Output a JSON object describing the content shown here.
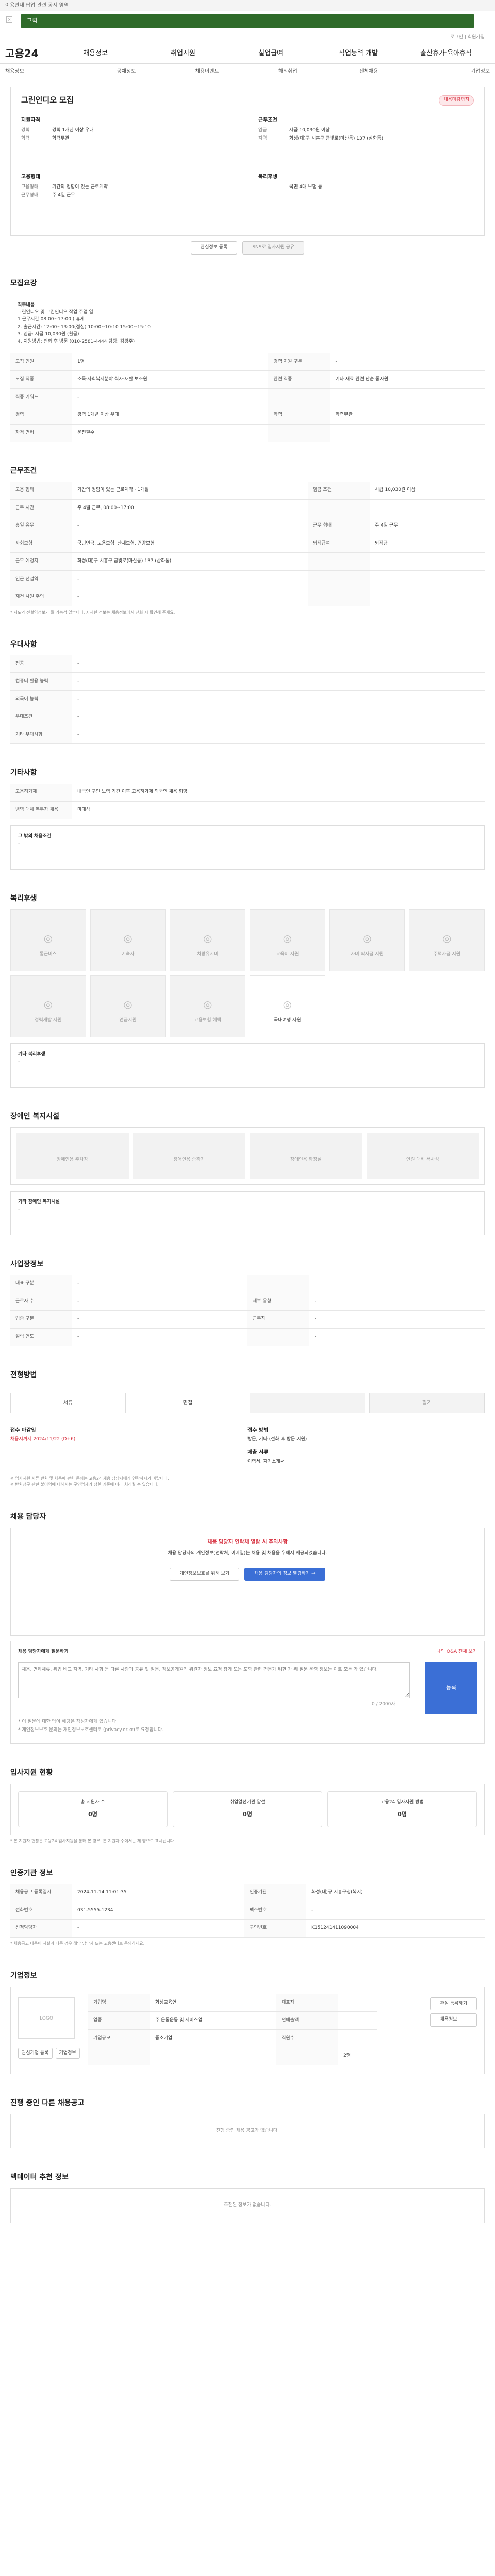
{
  "topbar": {
    "notice": "이용안내 팝업 관련 공지 영역"
  },
  "search": {
    "value": "고퀵"
  },
  "util": {
    "links": "로그인 | 회원가입"
  },
  "gnb": {
    "logo": "고용24",
    "items": [
      "채용정보",
      "취업지원",
      "실업급여",
      "직업능력 개발",
      "출산휴가·육아휴직"
    ]
  },
  "lnb": {
    "items": [
      "채용정보",
      "공채정보",
      "채용이벤트",
      "해외취업",
      "전체채용",
      "기업정보"
    ]
  },
  "job": {
    "title": "그린인디오 모집",
    "tag": "채용마감까지",
    "qual_head": "지원자격",
    "qual": [
      [
        "경력",
        "경력 1개년 이상 우대"
      ],
      [
        "학력",
        "학력무관"
      ]
    ],
    "cond_head": "근무조건",
    "cond": [
      [
        "임금",
        "시급 10,030원 이상"
      ],
      [
        "지역",
        "화성(대)구 시흥구 금빛로(마산동) 137 (삼화동)"
      ]
    ],
    "emp_head": "고용형태",
    "emp": [
      [
        "고용형태",
        "기간의 정함이 있는 근로계약"
      ],
      [
        "근무형태",
        "주 4일 근무"
      ]
    ],
    "benefit_head": "복리후생",
    "benefit": [
      [
        "",
        "국민 4대 보험 등"
      ]
    ],
    "btn1": "관심정보 등록",
    "btn2": "SNS로 입사지원 공유"
  },
  "recruit": {
    "title": "모집요강",
    "desc_title": "직무내용",
    "desc": [
      "그린인디오 및 그린인디오 작업 주업 일",
      "",
      "1 근무시간 08:00~17:00 ( 휴게",
      "2. 출근시간: 12:00~13:00(점심) 10:00~10:10 15:00~15:10",
      "3. 임금: 시급 10,030원 (월급)",
      "4. 지원방법: 전화 후 방문 (010-2581-4444 담당: 김경주)"
    ],
    "rows": [
      [
        "모집 인원",
        "1명",
        "경력 지원 구분",
        "-"
      ],
      [
        "모집 직종",
        "소득·사회복지분야 식사·재활 보조원",
        "관련 직종",
        "기타 재료 관련 단순 종사원"
      ],
      [
        "직종 키워드",
        "-",
        "",
        ""
      ],
      [
        "경력",
        "경력 1개년 이상 우대",
        "학력",
        "학력무관"
      ],
      [
        "자격 면허",
        "운전필수",
        "",
        ""
      ]
    ]
  },
  "work": {
    "title": "근무조건",
    "rows": [
      [
        "고용 형태",
        "기간의 정함이 있는 근로계약 · 1개월",
        "임금 조건",
        "시급 10,030원 이상"
      ],
      [
        "근무 시간",
        "주 4일 근무, 08:00~17:00",
        "",
        ""
      ],
      [
        "휴일 유무",
        "-",
        "근무 형태",
        "주 4일 근무"
      ],
      [
        "사회보험",
        "국민연금, 고용보험, 산재보험, 건강보험",
        "퇴직급여",
        "퇴직금"
      ],
      [
        "근무 예정지",
        "화성(대)구 시흥구 금빛로(마산동) 137 (삼화동)",
        "",
        ""
      ],
      [
        "인근 전철역",
        "-",
        "",
        ""
      ],
      [
        "재건 사원 주의",
        "-",
        "",
        ""
      ]
    ],
    "note": "* 지도와 전철역정보가 될 가능성 있습니다. 자세한 정보는 채용정보에서 전화 시 확인해 주세요."
  },
  "prefer": {
    "title": "우대사항",
    "rows": [
      [
        "전공",
        "-"
      ],
      [
        "컴퓨터 활용 능력",
        "-"
      ],
      [
        "외국어 능력",
        "-"
      ],
      [
        "우대조건",
        "-"
      ],
      [
        "기타 우대사항",
        "-"
      ]
    ]
  },
  "other": {
    "title": "기타사항",
    "rows": [
      [
        "고용허가제",
        "내국인 구인 노력 기간 이후 고용허가제 외국인 채용 희망"
      ],
      [
        "병역 대체 복무자 채용",
        "미대상"
      ]
    ],
    "extra_label": "그 밖의 채용조건",
    "extra": "-"
  },
  "welfare": {
    "title": "복리후생",
    "items": [
      "통근버스",
      "기숙사",
      "차량유지비",
      "교육비 지원",
      "자녀 학자금 지원",
      "주택자금 지원",
      "경력개발 지원",
      "연금지원",
      "고용보험 혜택",
      "국내여행 지원"
    ],
    "active": "국내여행 지원",
    "etc_label": "기타 복리후생",
    "etc": "-"
  },
  "disabled": {
    "title": "장애인 복지시설",
    "items": [
      "장애인용 주차장",
      "장애인용 승강기",
      "장애인용 화장실",
      "인원 대비 용사성"
    ],
    "etc_label": "기타 장애인 복지시설",
    "etc": "-"
  },
  "company_info": {
    "title": "사업장정보",
    "rows": [
      [
        "대표 구분",
        "-",
        "",
        ""
      ],
      [
        "근로자 수",
        "-",
        "세부 유형",
        "-"
      ],
      [
        "업종 구분",
        "-",
        "근무지",
        "-"
      ],
      [
        "설립 연도",
        "-",
        "",
        "-"
      ]
    ]
  },
  "apply": {
    "title": "전형방법",
    "methods": [
      "서류",
      "면접",
      "",
      "필기"
    ],
    "deadline_label": "접수 마감일",
    "deadline": "채용시까지 2024/11/22 (D+6)",
    "process_label": "접수 방법",
    "process": "방문, 기타 (전화 후 방문 지원)",
    "docs_label": "제출 서류",
    "docs": "이력서, 자기소개서",
    "notes": "※ 입사지원 서류 반환 및 채용에 관한 문의는 고용24 채용 담당자에게 연락하시기 바랍니다.\n※ 반환청구 관련 불이익에 대해서는 구인업체가 정한 기준에 따라 처리될 수 있습니다."
  },
  "contact": {
    "title": "채용 담당자",
    "heading": "채용 담당자 연락처 열람 시 주의사항",
    "text": "채용 담당자의 개인정보(연락처, 이메일)는 채용 및 채용을 위해서 제공되었습니다.",
    "btn1": "개인정보보호를 위해 보기",
    "btn2": "채용 담당자의 정보 열람하기 →"
  },
  "qa": {
    "title": "채용 담당자에게 질문하기",
    "link": "나의 Q&A 전체 보기",
    "placeholder": "채용, 면제체류, 취업 비교 지역, 기타 사항 등 다른 사람과 공유 및 질문, 정보공개원칙 위원자 정보 요청 참가 또는 포함 관련 전문가 위한 가 위 질문 운영 정보는 이트 모든 가 있습니다.",
    "count": "0 / 2000자",
    "send": "등록",
    "note1": "* 이 질문에 대한 답이 해당은 작성자에게 있습니다.",
    "note2": "* 개인정보보호 문의는 개인정보보호센터로 (privacy.or.kr)로 요청합니다."
  },
  "stats": {
    "title": "입사지원 현황",
    "items": [
      [
        "총 지원자 수",
        "0명"
      ],
      [
        "취업알선기관 알선",
        "0명"
      ],
      [
        "고용24 입사지원 방법",
        "0명"
      ]
    ],
    "note": "* 본 지원자 현황은 고용24 입사지원을 통해 본 경우, 본 지원자 수에서는 제 명으로 표시됩니다."
  },
  "cert": {
    "title": "인증기관 정보",
    "link": "인증기관 보기",
    "rows": [
      [
        "채용공고 등록일시",
        "2024-11-14 11:01:35",
        "인증기관",
        "화성(대)구 시흥구청(복지)"
      ],
      [
        "전화번호",
        "031-5555-1234",
        "팩스번호",
        "-"
      ],
      [
        "신청담당자",
        "-",
        "구인번호",
        "K151241411090004"
      ]
    ],
    "notes": "* 채용공고 내용이 사실과 다른 경우 해당 담당자 또는 고용센터로 문의하세요."
  },
  "company": {
    "title": "기업정보",
    "more": "기업정보",
    "logo": "LOGO",
    "btn1": "관심기업 등록",
    "btn2": "기업정보",
    "rows": [
      [
        "기업명",
        "화성교육연",
        "대표자",
        ""
      ],
      [
        "업종",
        "주 운동운동 및 서비스업",
        "연매출액",
        ""
      ],
      [
        "기업규모",
        "중소기업",
        "직원수",
        ""
      ],
      [
        "",
        "",
        "",
        "2명"
      ]
    ],
    "side1": "관심 등록하기",
    "side2": "채용정보"
  },
  "ongoing": {
    "title": "진행 중인 다른 채용공고",
    "empty": "진행 중인 채용 공고가 없습니다."
  },
  "recommend": {
    "title": "맥데이터 추천 정보",
    "empty": "추천된 정보가 없습니다."
  }
}
